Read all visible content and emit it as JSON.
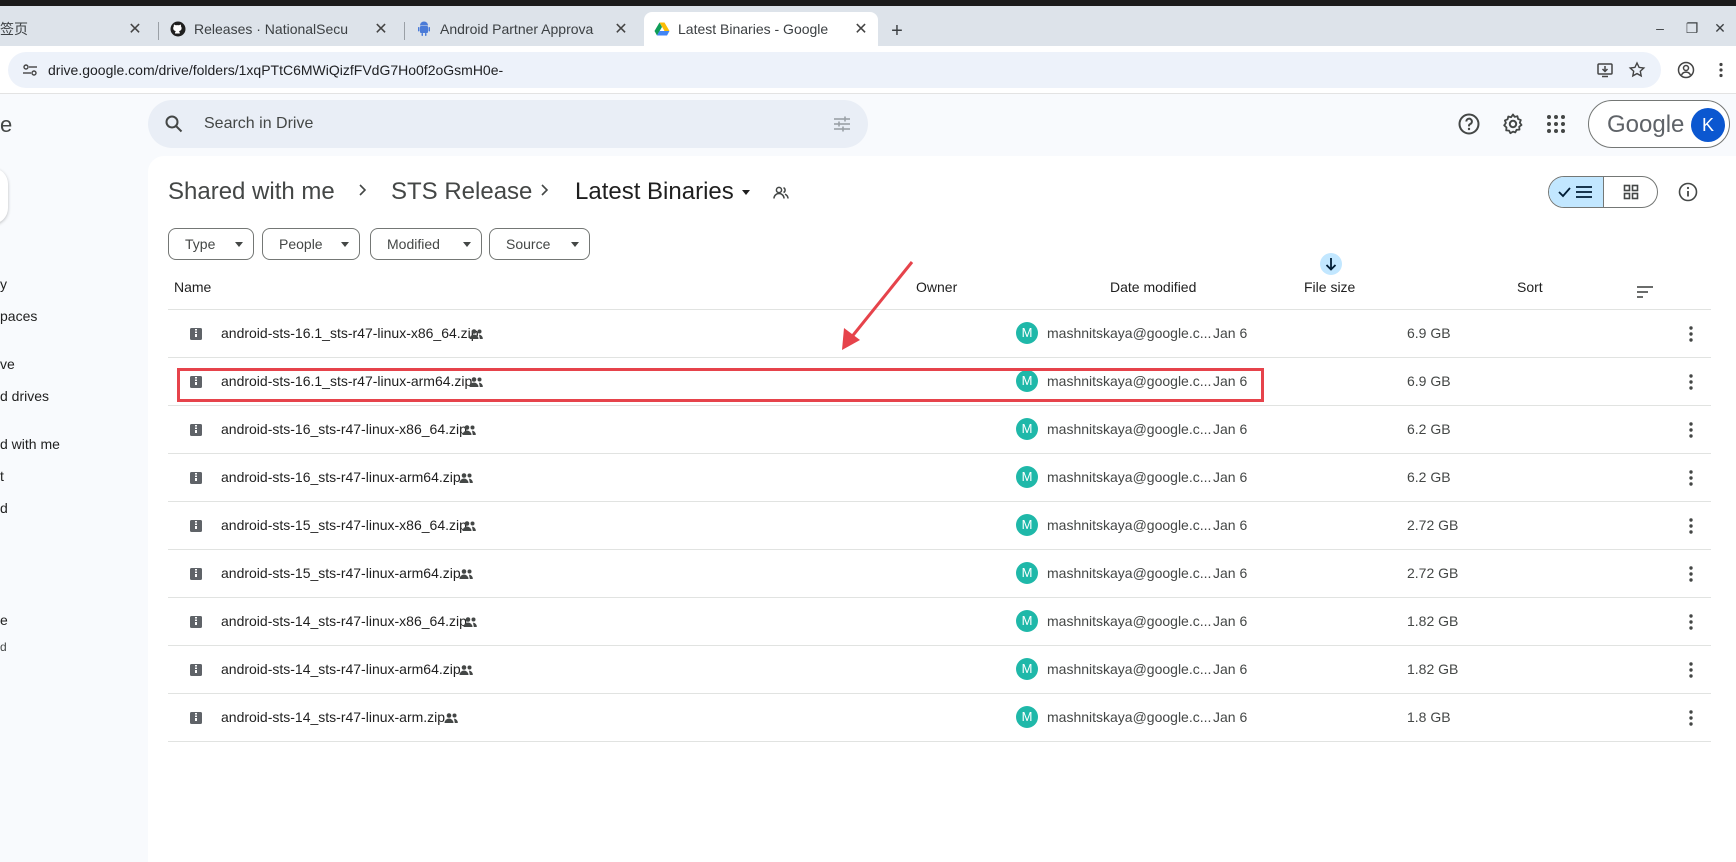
{
  "browser": {
    "tabs": [
      {
        "label": "签页",
        "close": "✕"
      },
      {
        "label": "Releases · NationalSecu",
        "close": "✕"
      },
      {
        "label": "Android Partner Approva",
        "close": "✕"
      },
      {
        "label": "Latest Binaries - Google",
        "close": "✕"
      }
    ],
    "new_tab": "+",
    "window_controls": {
      "minimize": "–",
      "restore": "❐",
      "close": "✕"
    },
    "url": "drive.google.com/drive/folders/1xqPTtC6MWiQizfFVdG7Ho0f2oGsmH0e-"
  },
  "sidebar": {
    "brand_fragment": "e",
    "items": [
      {
        "label": "y"
      },
      {
        "label": "paces"
      },
      {
        "label": "ve"
      },
      {
        "label": "d drives"
      },
      {
        "label": "d with me"
      },
      {
        "label": "t"
      },
      {
        "label": "d"
      },
      {
        "label": "e"
      },
      {
        "label": "d"
      }
    ]
  },
  "search": {
    "placeholder": "Search in Drive"
  },
  "account": {
    "wordmark": "Google",
    "initial": "K"
  },
  "breadcrumb": {
    "items": [
      "Shared with me",
      "STS Release",
      "Latest Binaries"
    ]
  },
  "filters": [
    "Type",
    "People",
    "Modified",
    "Source"
  ],
  "table": {
    "columns": {
      "name": "Name",
      "owner": "Owner",
      "date": "Date modified",
      "size": "File size",
      "sort": "Sort"
    },
    "rows": [
      {
        "name": "android-sts-16.1_sts-r47-linux-x86_64.zip",
        "owner_initial": "M",
        "owner": "mashnitskaya@google.c...",
        "date": "Jan 6",
        "size": "6.9 GB"
      },
      {
        "name": "android-sts-16.1_sts-r47-linux-arm64.zip",
        "owner_initial": "M",
        "owner": "mashnitskaya@google.c...",
        "date": "Jan 6",
        "size": "6.9 GB"
      },
      {
        "name": "android-sts-16_sts-r47-linux-x86_64.zip",
        "owner_initial": "M",
        "owner": "mashnitskaya@google.c...",
        "date": "Jan 6",
        "size": "6.2 GB"
      },
      {
        "name": "android-sts-16_sts-r47-linux-arm64.zip",
        "owner_initial": "M",
        "owner": "mashnitskaya@google.c...",
        "date": "Jan 6",
        "size": "6.2 GB"
      },
      {
        "name": "android-sts-15_sts-r47-linux-x86_64.zip",
        "owner_initial": "M",
        "owner": "mashnitskaya@google.c...",
        "date": "Jan 6",
        "size": "2.72 GB"
      },
      {
        "name": "android-sts-15_sts-r47-linux-arm64.zip",
        "owner_initial": "M",
        "owner": "mashnitskaya@google.c...",
        "date": "Jan 6",
        "size": "2.72 GB"
      },
      {
        "name": "android-sts-14_sts-r47-linux-x86_64.zip",
        "owner_initial": "M",
        "owner": "mashnitskaya@google.c...",
        "date": "Jan 6",
        "size": "1.82 GB"
      },
      {
        "name": "android-sts-14_sts-r47-linux-arm64.zip",
        "owner_initial": "M",
        "owner": "mashnitskaya@google.c...",
        "date": "Jan 6",
        "size": "1.82 GB"
      },
      {
        "name": "android-sts-14_sts-r47-linux-arm.zip",
        "owner_initial": "M",
        "owner": "mashnitskaya@google.c...",
        "date": "Jan 6",
        "size": "1.8 GB"
      }
    ]
  },
  "colors": {
    "accent": "#0b57d0",
    "selected_chip": "#c2e7ff",
    "owner_avatar": "#1fb8a9",
    "annotation": "#e6434b"
  },
  "icons": [
    "github-icon",
    "android-icon",
    "drive-icon",
    "search-icon",
    "tune-icon",
    "help-icon",
    "settings-icon",
    "apps-icon",
    "zip-icon",
    "shared-icon",
    "more-vert-icon",
    "arrow-down-icon",
    "sort-icon",
    "info-icon"
  ]
}
